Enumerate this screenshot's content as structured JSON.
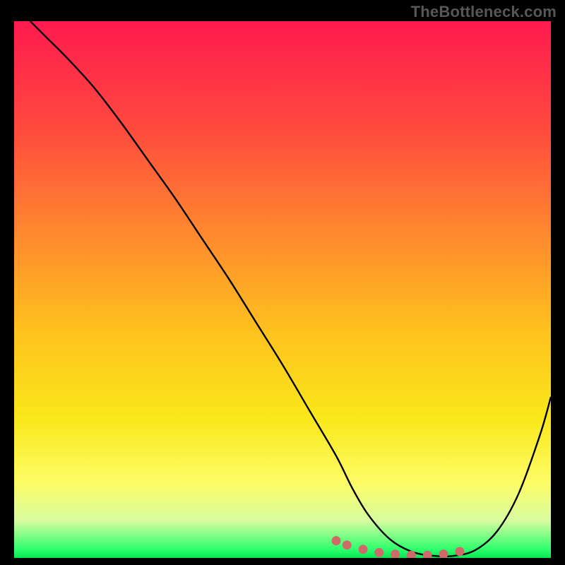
{
  "watermark": "TheBottleneck.com",
  "chart_data": {
    "type": "line",
    "title": "",
    "xlabel": "",
    "ylabel": "",
    "xlim": [
      0,
      100
    ],
    "ylim": [
      0,
      100
    ],
    "grid": false,
    "legend": false,
    "series": [
      {
        "name": "bottleneck-curve",
        "color": "#000000",
        "x": [
          3,
          6,
          10,
          15,
          20,
          25,
          30,
          35,
          40,
          45,
          50,
          55,
          60,
          63,
          66,
          70,
          74,
          78,
          82,
          86,
          90,
          94,
          98,
          100
        ],
        "y": [
          100,
          97,
          93,
          87.5,
          81,
          74,
          67,
          59.5,
          52,
          44,
          36,
          27.5,
          19,
          13,
          8,
          3.5,
          1.2,
          0.4,
          0.4,
          1.5,
          5,
          12,
          23,
          30
        ]
      },
      {
        "name": "low-bottleneck-markers",
        "color": "#cf6a6a",
        "marker": "circle",
        "x": [
          60,
          62,
          65,
          68,
          71,
          74,
          77,
          80,
          83
        ],
        "y": [
          3.2,
          2.4,
          1.6,
          1.0,
          0.7,
          0.5,
          0.5,
          0.7,
          1.2
        ]
      }
    ],
    "background_gradient_stops": [
      {
        "offset": 0.0,
        "color": "#ff1a4f"
      },
      {
        "offset": 0.2,
        "color": "#ff4a3e"
      },
      {
        "offset": 0.4,
        "color": "#ff8a2e"
      },
      {
        "offset": 0.58,
        "color": "#ffc21e"
      },
      {
        "offset": 0.74,
        "color": "#f9e81a"
      },
      {
        "offset": 0.86,
        "color": "#fdfc66"
      },
      {
        "offset": 0.93,
        "color": "#d9fca0"
      },
      {
        "offset": 0.985,
        "color": "#2bff6b"
      },
      {
        "offset": 1.0,
        "color": "#06e653"
      }
    ]
  }
}
